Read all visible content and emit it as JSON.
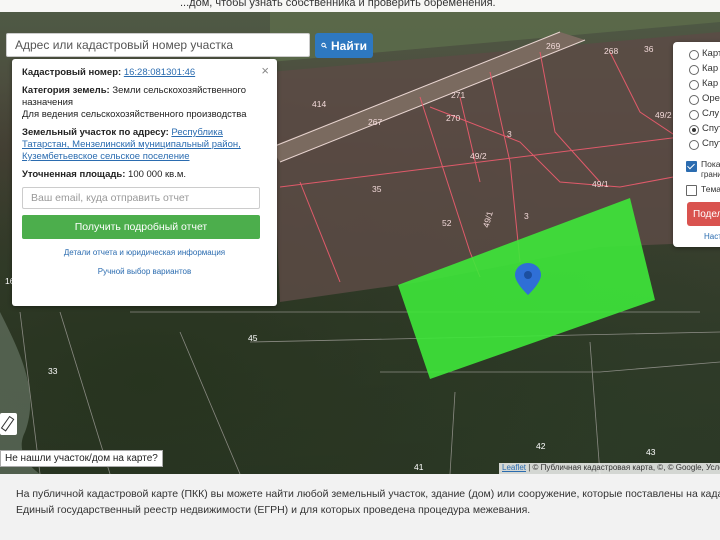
{
  "header": {
    "cut_text": "...дом, чтобы узнать собственника и проверить обременения."
  },
  "search": {
    "placeholder": "Адрес или кадастровый номер участка",
    "button_label": "Найти"
  },
  "info_panel": {
    "close": "×",
    "cadastral_label": "Кадастровый номер:",
    "cadastral_value": "16:28:081301:46",
    "category_label": "Категория земель:",
    "category_value": "Земли сельскохозяйственного назначения",
    "usage": "Для ведения сельскохозяйственного производства",
    "address_label": "Земельный участок по адресу:",
    "address_value": "Республика Татарстан, Мензелинский муниципальный район, Кузембетьевское сельское поселение",
    "area_label": "Уточненная площадь:",
    "area_value": "100 000 кв.м.",
    "email_placeholder": "Ваш email, куда отправить отчет",
    "report_button": "Получить подробный отчет",
    "details_link": "Детали отчета и юридическая информация",
    "manual_link": "Ручной выбор вариантов"
  },
  "layers_panel": {
    "options": [
      "Карт",
      "Кар",
      "Кар",
      "Орео",
      "Слу",
      "Спут",
      "Спут"
    ],
    "checks": [
      {
        "label": "Показ",
        "label2": "грани",
        "checked": true
      },
      {
        "label": "Темат",
        "checked": false
      }
    ],
    "share_button": "Подел",
    "settings_link": "Наст"
  },
  "map": {
    "plot_labels": [
      "269",
      "268",
      "36",
      "414",
      "271",
      "267",
      "270",
      "3",
      "49/2",
      "49/2",
      "49/1",
      "35",
      "52",
      "49/1",
      "3",
      "45",
      "33",
      "42",
      "43",
      "41",
      "16"
    ],
    "not_found_button": "Не нашли участок/дом на карте?",
    "attribution_leaflet": "Leaflet",
    "attribution_rest": " | © Публичная кадастровая карта, ©, © Google, Условия"
  },
  "footer": {
    "line1": "На публичной кадастровой карте (ПКК) вы можете найти любой земельный участок, здание (дом) или сооружение, которые поставлены на кадастровый уче",
    "line2": "Единый государственный реестр недвижимости (ЕГРН) и для которых проведена процедура межевания."
  },
  "colors": {
    "accent": "#2e78c0",
    "green_button": "#4cae4c",
    "highlight": "#3ee83a",
    "marker": "#2f6fd6",
    "share": "#d9534f"
  }
}
